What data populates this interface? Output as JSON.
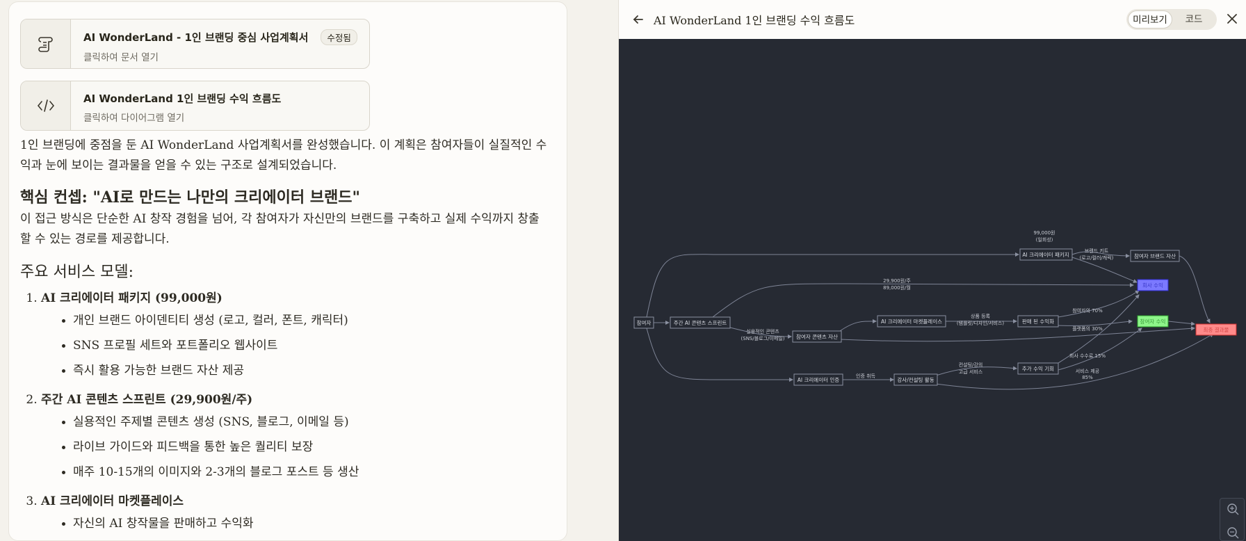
{
  "cards": [
    {
      "title": "AI WonderLand - 1인 브랜딩 중심 사업계획서",
      "subtitle": "클릭하여 문서 열기",
      "badge": "수정됨",
      "icon": "document-icon"
    },
    {
      "title": "AI WonderLand 1인 브랜딩 수익 흐름도",
      "subtitle": "클릭하여 다이어그램 열기",
      "icon": "code-icon"
    }
  ],
  "chat": {
    "intro": "1인 브랜딩에 중점을 둔 AI WonderLand 사업계획서를 완성했습니다. 이 계획은 참여자들이 실질적인 수익과 눈에 보이는 결과물을 얻을 수 있는 구조로 설계되었습니다.",
    "core_heading": "핵심 컨셉: \"AI로 만드는 나만의 크리에이터 브랜드\"",
    "core_text": "이 접근 방식은 단순한 AI 창작 경험을 넘어, 각 참여자가 자신만의 브랜드를 구축하고 실제 수익까지 창출할 수 있는 경로를 제공합니다.",
    "services_heading": "주요 서비스 모델:",
    "services": [
      {
        "title": "AI 크리에이터 패키지 (99,000원)",
        "items": [
          "개인 브랜드 아이덴티티 생성 (로고, 컬러, 폰트, 캐릭터)",
          "SNS 프로필 세트와 포트폴리오 웹사이트",
          "즉시 활용 가능한 브랜드 자산 제공"
        ]
      },
      {
        "title": "주간 AI 콘텐츠 스프린트 (29,900원/주)",
        "items": [
          "실용적인 주제별 콘텐츠 생성 (SNS, 블로그, 이메일 등)",
          "라이브 가이드와 피드백을 통한 높은 퀄리티 보장",
          "매주 10-15개의 이미지와 2-3개의 블로그 포스트 등 생산"
        ]
      },
      {
        "title": "AI 크리에이터 마켓플레이스",
        "items": [
          "자신의 AI 창작물을 판매하고 수익화"
        ]
      }
    ]
  },
  "artifact": {
    "title": "AI WonderLand 1인 브랜딩 수익 흐름도",
    "tab_preview": "미리보기",
    "tab_code": "코드"
  },
  "diagram": {
    "nodes": [
      {
        "id": "n1",
        "label": "참여자"
      },
      {
        "id": "n2",
        "label": "주간 AI 콘텐츠 스프린트"
      },
      {
        "id": "n3",
        "label": "참여자 콘텐츠 자산"
      },
      {
        "id": "n4",
        "label": "AI 크리에이터 마켓플레이스"
      },
      {
        "id": "n5",
        "label": "판매 된 수익화"
      },
      {
        "id": "n6",
        "label": "AI 크리에이터 패키지"
      },
      {
        "id": "n7",
        "label": "참여자 브랜드 자산"
      },
      {
        "id": "n8",
        "label": "회사 수익"
      },
      {
        "id": "n9",
        "label": "참여자 수익"
      },
      {
        "id": "n10",
        "label": "최종 결과물"
      },
      {
        "id": "n11",
        "label": "AI 크리에이터 인증"
      },
      {
        "id": "n12",
        "label": "강사/컨설팅 활동"
      },
      {
        "id": "n13",
        "label": "추가 수익 기회"
      }
    ],
    "edge_labels": {
      "e_price_pkg": "99,000원",
      "e_price_pkg2": "(일회성)",
      "e_brand_kit": "브랜드 키트",
      "e_brand_kit2": "(로고/컬러/캐릭)",
      "e_price_sprint": "29,900원/주",
      "e_price_sprint2": "89,000원/월",
      "e_practical": "실용적인 콘텐츠",
      "e_practical2": "(SNS/블로그/이메일)",
      "e_sale": "상품 등록",
      "e_sale2": "(템플릿/디자인/서비스)",
      "e_fee70": "참여자의 70%",
      "e_fee30": "플랫폼의 30%",
      "e_cert": "인증 취득",
      "e_lecture": "컨설팅/강의",
      "e_lecture2": "고급 서비스",
      "e_rev15": "회사 수수료 15%",
      "e_rev85": "서비스 제공",
      "e_rev85b": "85%"
    }
  },
  "colors": {
    "diagram_bg": "#262a33",
    "node_border": "#8a90a0",
    "edge": "#8a90a0",
    "node_blue": "#7b79ff",
    "node_green": "#8ef58a",
    "node_red": "#ff8a8a"
  }
}
